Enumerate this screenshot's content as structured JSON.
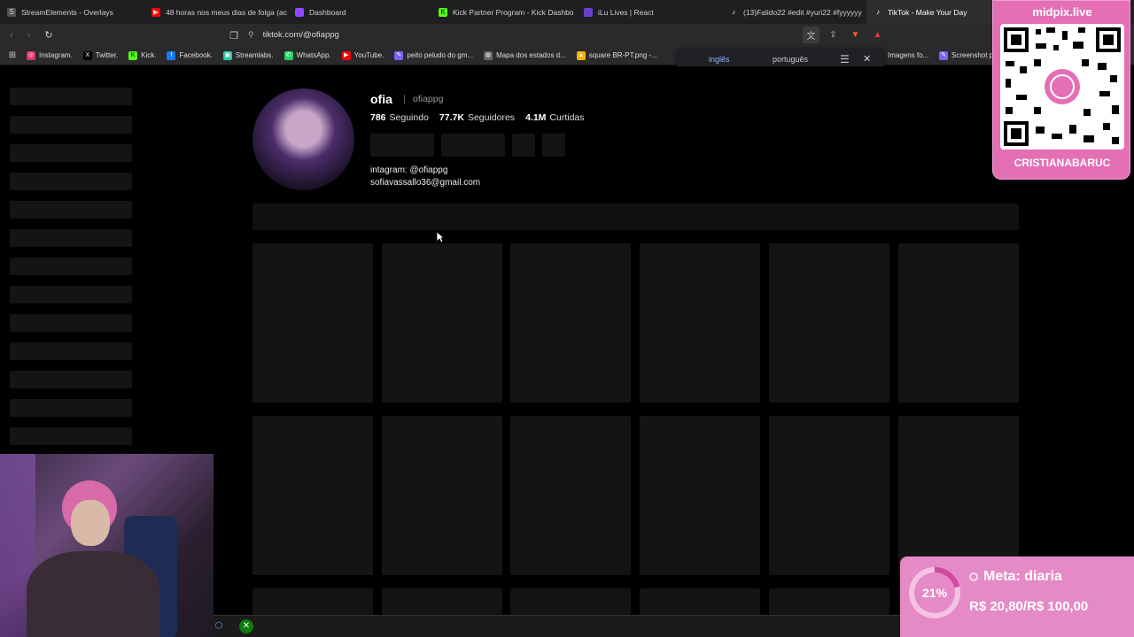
{
  "tabs": [
    {
      "title": "StreamElements - Overlays",
      "icon": "streamelements-icon",
      "color": "#cfcfcf"
    },
    {
      "title": "48 horas nos meus dias de folga (ac",
      "icon": "youtube-icon",
      "color": "#ff0000"
    },
    {
      "title": "Dashboard",
      "icon": "twitch-icon",
      "color": "#9146ff"
    },
    {
      "title": "Kick Partner Program - Kick Dashbo",
      "icon": "kick-icon",
      "color": "#53fc18"
    },
    {
      "title": "iLu Lives | React",
      "icon": "twitch-icon",
      "color": "#9146ff"
    },
    {
      "title": "(13)Falido22 #edit #yuri22 #fyyyyyy",
      "icon": "tiktok-icon",
      "color": "#ffffff"
    },
    {
      "title": "TikTok - Make Your Day",
      "icon": "tiktok-icon",
      "color": "#ffffff"
    }
  ],
  "address": {
    "url": "tiktok.com/@ofiappg"
  },
  "bookmarks": [
    {
      "label": "Instagram.",
      "icon": "instagram-icon",
      "color": "#e1306c"
    },
    {
      "label": "Twitter.",
      "icon": "x-icon",
      "color": "#000000"
    },
    {
      "label": "Kick.",
      "icon": "kick-icon",
      "color": "#53fc18"
    },
    {
      "label": "Facebook.",
      "icon": "facebook-icon",
      "color": "#1877f2"
    },
    {
      "label": "Streamlabs.",
      "icon": "streamlabs-icon",
      "color": "#31c3a2"
    },
    {
      "label": "WhatsApp.",
      "icon": "whatsapp-icon",
      "color": "#25d366"
    },
    {
      "label": "YouTube.",
      "icon": "youtube-icon",
      "color": "#ff0000"
    },
    {
      "label": "peito peludo do gm...",
      "icon": "pencil-icon",
      "color": "#7b61ff"
    },
    {
      "label": "Mapa dos estados d...",
      "icon": "globe-icon",
      "color": "#888888"
    },
    {
      "label": "square BR-PT.png -...",
      "icon": "drive-icon",
      "color": "#f4b400"
    }
  ],
  "bookmarks_right": [
    {
      "label": "Imagens fo..."
    },
    {
      "label": "Screenshot p"
    }
  ],
  "translate": {
    "from": "inglês",
    "to": "português"
  },
  "profile": {
    "username": "ofia",
    "handle": "ofiappg",
    "following_count": "786",
    "following_label": "Seguindo",
    "followers_count": "77.7K",
    "followers_label": "Seguidores",
    "likes_count": "4.1M",
    "likes_label": "Curtidas",
    "bio_line1": "intagram: @ofiappg",
    "bio_line2": "sofiavassallo36@gmail.com"
  },
  "qr_overlay": {
    "title": "midpix.live",
    "name": "CRISTIANABARUC"
  },
  "goal": {
    "percent_label": "21%",
    "progress": 0.21,
    "title": "Meta: diaria",
    "amount": "R$ 20,80/R$ 100,00"
  }
}
